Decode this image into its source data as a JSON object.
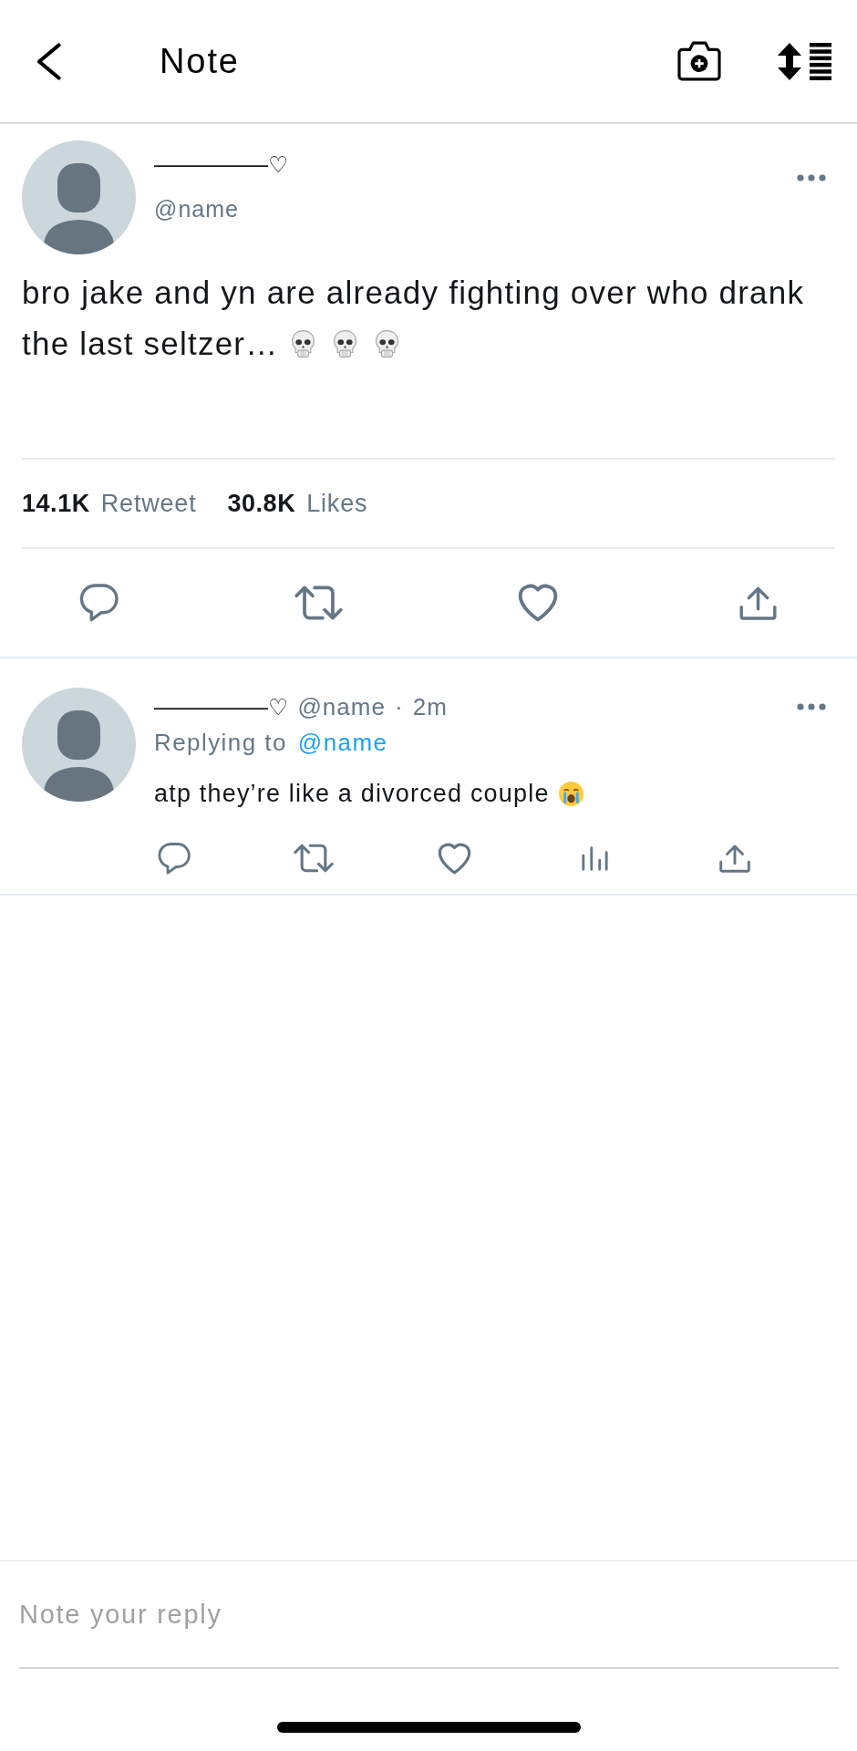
{
  "header": {
    "title": "Note"
  },
  "tweet": {
    "author": {
      "name": "—————♡",
      "handle": "@name"
    },
    "text_lines": [
      "bro jake and yn are already fighting over who drank",
      "the last seltzer…"
    ],
    "emoji": [
      {
        "kind": "skull"
      },
      {
        "kind": "skull"
      },
      {
        "kind": "skull"
      }
    ],
    "stats": [
      {
        "count": "14.1K",
        "label": "Retweet"
      },
      {
        "count": "30.8K",
        "label": "Likes"
      }
    ],
    "actions": [
      {
        "kind": "reply"
      },
      {
        "kind": "retweet"
      },
      {
        "kind": "like"
      },
      {
        "kind": "share"
      }
    ]
  },
  "replies": [
    {
      "author": {
        "name": "—————♡",
        "handle": "@name"
      },
      "separator": "·",
      "time": "2m",
      "replying_to": {
        "label": "Replying to",
        "handle": "@name"
      },
      "text": "atp they’re like a divorced couple",
      "emoji": [
        {
          "kind": "crying"
        }
      ],
      "actions": [
        {
          "kind": "reply"
        },
        {
          "kind": "retweet"
        },
        {
          "kind": "like"
        },
        {
          "kind": "views"
        },
        {
          "kind": "share"
        }
      ]
    }
  ],
  "composer": {
    "placeholder": "Note your reply"
  }
}
